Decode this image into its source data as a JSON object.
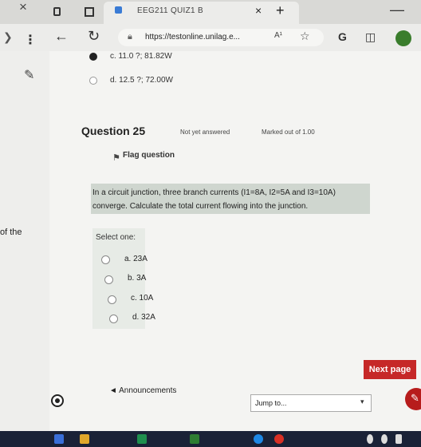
{
  "browser": {
    "tab_title": "EEG211 QUIZ1 B",
    "tab_close": "×",
    "new_tab": "+",
    "window_min": "—",
    "window_close": "×",
    "url": "https://testonline.unilag.e...",
    "read_aloud": "A¹"
  },
  "sidebar": {
    "edge_text": "of the"
  },
  "previous_options": [
    {
      "label": "c. 11.0 ?; 81.82W",
      "checked": true
    },
    {
      "label": "d. 12.5 ?; 72.00W",
      "checked": false
    }
  ],
  "question": {
    "title": "Question 25",
    "status": "Not yet answered",
    "marks": "Marked out of 1.00",
    "flag_label": "Flag question",
    "text": "In a circuit junction, three branch currents (I1=8A, I2=5A and I3=10A) converge. Calculate the total current flowing into the junction.",
    "select_label": "Select one:",
    "answers": [
      {
        "label": "a. 23A"
      },
      {
        "label": "b. 3A"
      },
      {
        "label": "c. 10A"
      },
      {
        "label": "d. 32A"
      }
    ]
  },
  "nav": {
    "next_label": "Next page",
    "prev_link": "◄ Announcements",
    "jump_label": "Jump to...",
    "jump_chevron": "▾"
  },
  "colors": {
    "accent": "#c62828",
    "highlight": "#cfd6cf"
  }
}
